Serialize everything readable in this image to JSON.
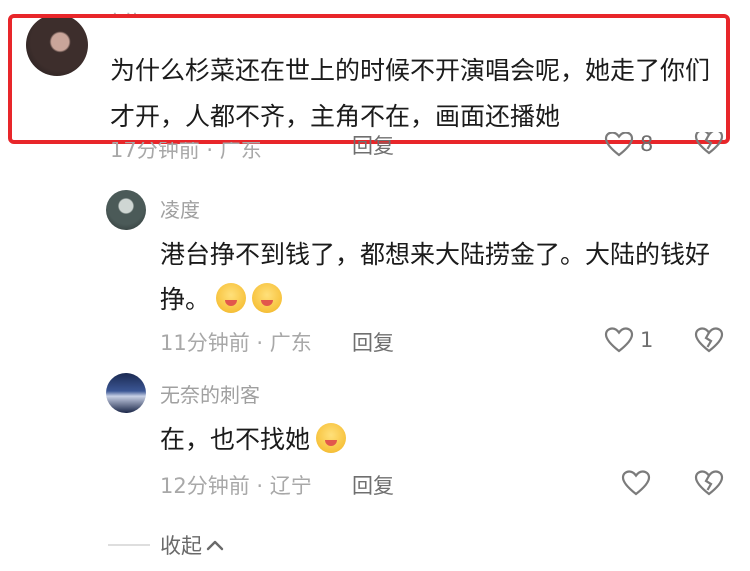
{
  "top_comment": {
    "username_partial": "· ··",
    "text": "为什么杉菜还在世上的时候不开演唱会呢，她走了你们才开，人都不齐，主角不在，画面还播她",
    "meta": "17分钟前 · 广东",
    "reply_label": "回复",
    "like_count": "8"
  },
  "comments": [
    {
      "username": "凌度",
      "text": "港台挣不到钱了，都想来大陆捞金了。大陆的钱好挣。",
      "emojis": [
        "grin-emoji",
        "grin-emoji"
      ],
      "meta": "11分钟前 · 广东",
      "reply_label": "回复",
      "like_count": "1"
    },
    {
      "username": "无奈的刺客",
      "text": "在，也不找她",
      "emojis": [
        "pouting-emoji"
      ],
      "meta": "12分钟前 · 辽宁",
      "reply_label": "回复",
      "like_count": ""
    }
  ],
  "collapse": {
    "label": "收起"
  },
  "colors": {
    "highlight": "#e8262a",
    "text": "#1b1b1b",
    "meta": "#a8a8a8"
  }
}
